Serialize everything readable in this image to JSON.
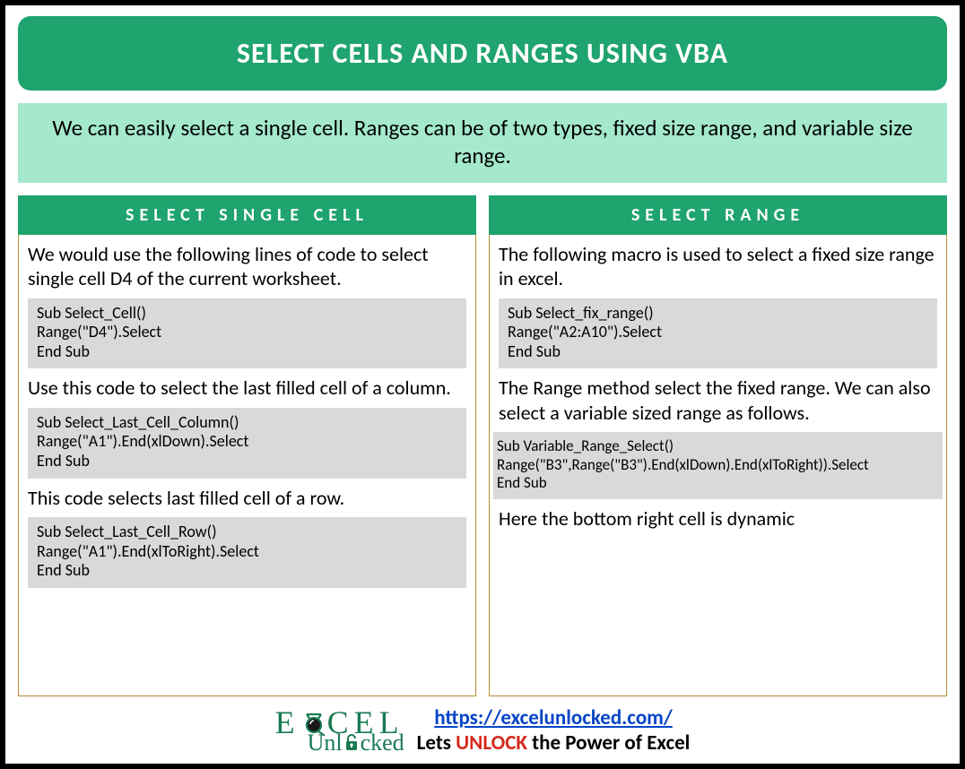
{
  "title": "SELECT CELLS AND RANGES USING VBA",
  "intro": "We can easily select a single cell. Ranges can be of two types, fixed size range, and variable size range.",
  "left": {
    "header": "SELECT SINGLE CELL",
    "p1": "We would use the following lines of code to select single cell D4 of the current worksheet.",
    "code1": "Sub Select_Cell()\nRange(\"D4\").Select\nEnd Sub",
    "p2": "Use this code to select the last filled cell of a column.",
    "code2": "Sub Select_Last_Cell_Column()\nRange(\"A1\").End(xlDown).Select\nEnd Sub",
    "p3": "This code selects last filled cell of a row.",
    "code3": "Sub Select_Last_Cell_Row()\nRange(\"A1\").End(xlToRight).Select\nEnd Sub"
  },
  "right": {
    "header": "SELECT RANGE",
    "p1": "The following macro is used to select a fixed size range in excel.",
    "code1": "Sub Select_fix_range()\nRange(\"A2:A10\").Select\nEnd Sub",
    "p2": "The Range method select the fixed range. We can also select a variable sized range as follows.",
    "code2": "Sub Variable_Range_Select()\nRange(\"B3\",Range(\"B3\").End(xlDown).End(xlToRight)).Select\nEnd Sub",
    "p3": "Here the bottom right cell is dynamic"
  },
  "footer": {
    "url_text": "https://excelunlocked.com/",
    "tagline_prefix": "Lets ",
    "tagline_unlock": "UNLOCK",
    "tagline_suffix": " the Power of Excel",
    "logo_top_left": "E",
    "logo_top_right": "CEL",
    "logo_bottom_prefix": "Unl",
    "logo_bottom_suffix": "cked"
  }
}
